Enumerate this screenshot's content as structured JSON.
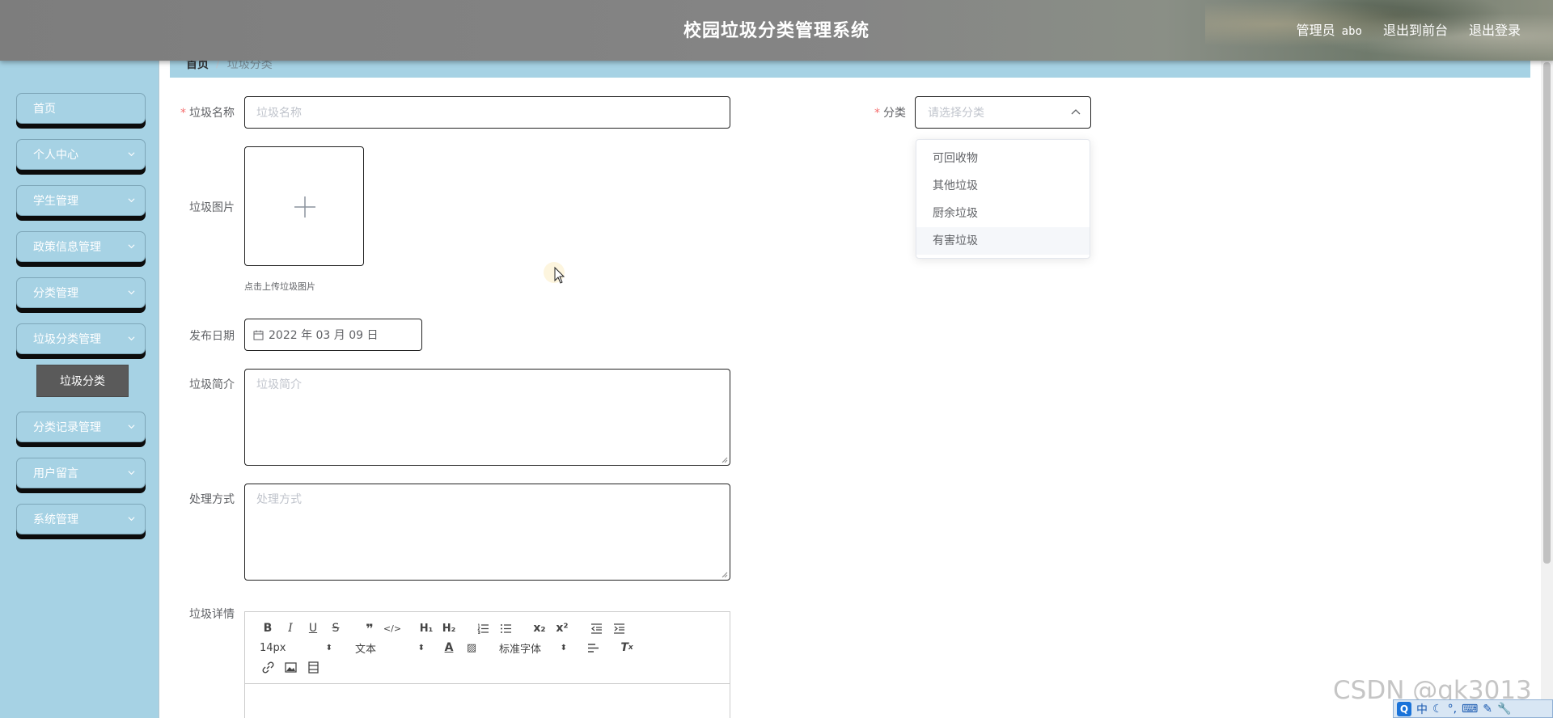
{
  "header": {
    "title": "校园垃圾分类管理系统",
    "role_label": "管理员",
    "username": "abo",
    "front_link": "退出到前台",
    "logout_link": "退出登录"
  },
  "sidebar": {
    "items": [
      {
        "label": "首页",
        "has_arrow": false
      },
      {
        "label": "个人中心",
        "has_arrow": true
      },
      {
        "label": "学生管理",
        "has_arrow": true
      },
      {
        "label": "政策信息管理",
        "has_arrow": true
      },
      {
        "label": "分类管理",
        "has_arrow": true
      },
      {
        "label": "垃圾分类管理",
        "has_arrow": true
      },
      {
        "label": "分类记录管理",
        "has_arrow": true
      },
      {
        "label": "用户留言",
        "has_arrow": true
      },
      {
        "label": "系统管理",
        "has_arrow": true
      }
    ],
    "active_sub": "垃圾分类"
  },
  "breadcrumb": {
    "home": "首页",
    "separator": "/",
    "current": "垃圾分类"
  },
  "form": {
    "name_label": "垃圾名称",
    "name_placeholder": "垃圾名称",
    "category_label": "分类",
    "category_placeholder": "请选择分类",
    "image_label": "垃圾图片",
    "upload_hint": "点击上传垃圾图片",
    "date_label": "发布日期",
    "date_value": "2022 年 03 月 09 日",
    "intro_label": "垃圾简介",
    "intro_placeholder": "垃圾简介",
    "method_label": "处理方式",
    "method_placeholder": "处理方式",
    "detail_label": "垃圾详情"
  },
  "dropdown": {
    "options": [
      "可回收物",
      "其他垃圾",
      "厨余垃圾",
      "有害垃圾"
    ],
    "hovered_index": 3
  },
  "editor": {
    "font_size": "14px",
    "header_select": "文本",
    "font_family": "标准字体"
  },
  "watermark": "CSDN @qk3013",
  "ime": {
    "lang": "中"
  },
  "colors": {
    "sidebar_bg": "#a6d2e4",
    "header_bg": "#808080",
    "required": "#f56c6c",
    "submenu_active": "#5a5a5a"
  }
}
